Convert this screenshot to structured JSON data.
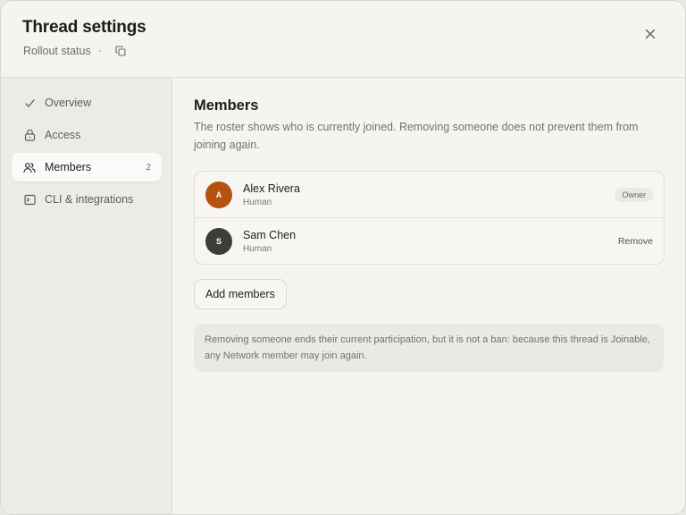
{
  "header": {
    "title": "Thread settings",
    "subtitle": "Rollout status",
    "separator": "·",
    "copy_icon": "copy-icon",
    "close_icon": "close-icon"
  },
  "sidebar": {
    "items": [
      {
        "label": "Overview",
        "icon": "check-icon",
        "active": false
      },
      {
        "label": "Access",
        "icon": "lock-icon",
        "active": false
      },
      {
        "label": "Members",
        "icon": "users-icon",
        "active": true,
        "count": "2"
      },
      {
        "label": "CLI & integrations",
        "icon": "terminal-icon",
        "active": false
      }
    ]
  },
  "main": {
    "title": "Members",
    "description": "The roster shows who is currently joined. Removing someone does not prevent them from joining again.",
    "members": [
      {
        "initial": "A",
        "name": "Alex Rivera",
        "type": "Human",
        "role": "Owner",
        "avatar_color": "#b5520f"
      },
      {
        "initial": "S",
        "name": "Sam Chen",
        "type": "Human",
        "action": "Remove",
        "avatar_color": "#3f3d3a"
      }
    ],
    "add_button": "Add members",
    "note": "Removing someone ends their current participation, but it is not a ban: because this thread is Joinable, any Network member may join again."
  },
  "colors": {
    "background": "#f5f4f0",
    "sidebar_bg": "#ecebe7",
    "active_item_bg": "#fbfaf8",
    "border": "#dedcd7"
  }
}
